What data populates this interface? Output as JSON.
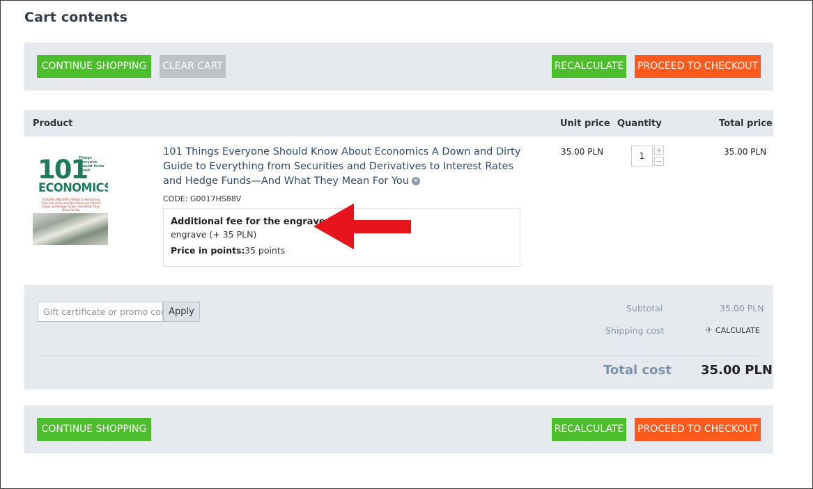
{
  "page": {
    "title": "Cart contents"
  },
  "buttons": {
    "continue_shopping": "CONTINUE SHOPPING",
    "clear_cart": "CLEAR CART",
    "recalculate": "RECALCULATE",
    "proceed_to_checkout": "PROCEED TO CHECKOUT"
  },
  "table": {
    "headers": {
      "product": "Product",
      "unit_price": "Unit price",
      "quantity": "Quantity",
      "total_price": "Total price"
    }
  },
  "item": {
    "cover": {
      "number": "101",
      "small_text": "Things Everyone Should Know about",
      "word": "ECONOMICS",
      "subtitle": "A DOWN AND DIRTY GUIDE to Everything from Securities and Derivatives to Interest Rates and Hedge Funds—And What They Mean for You"
    },
    "name": "101 Things Everyone Should Know About Economics A Down and Dirty Guide to Everything from Securities and Derivatives to Interest Rates and Hedge Funds—And What They Mean For You",
    "remove_icon": "close-circle-icon",
    "code": "CODE: G0017HS88V",
    "option_title": "Additional fee for the engraver:",
    "option_value": "engrave (+ 35  PLN)",
    "points_label": "Price in points:",
    "points_value": "35 points",
    "unit_price": "35.00 PLN",
    "quantity": "1",
    "qty_plus": "+",
    "qty_minus": "−",
    "total_price": "35.00 PLN"
  },
  "summary": {
    "promo_placeholder": "Gift certificate or promo code",
    "apply_label": "Apply",
    "subtotal_label": "Subtotal",
    "subtotal_value": "35.00 PLN",
    "shipping_label": "Shipping cost",
    "shipping_action": "CALCULATE",
    "shipping_icon": "airplane-icon",
    "total_label": "Total cost",
    "total_value": "35.00 PLN"
  },
  "colors": {
    "green_button": "#4cbe2c",
    "gray_button": "#bec2c7",
    "orange_button": "#ff5a1e",
    "panel_bg": "#e6e9ee",
    "annotation_arrow": "#e8141c"
  }
}
